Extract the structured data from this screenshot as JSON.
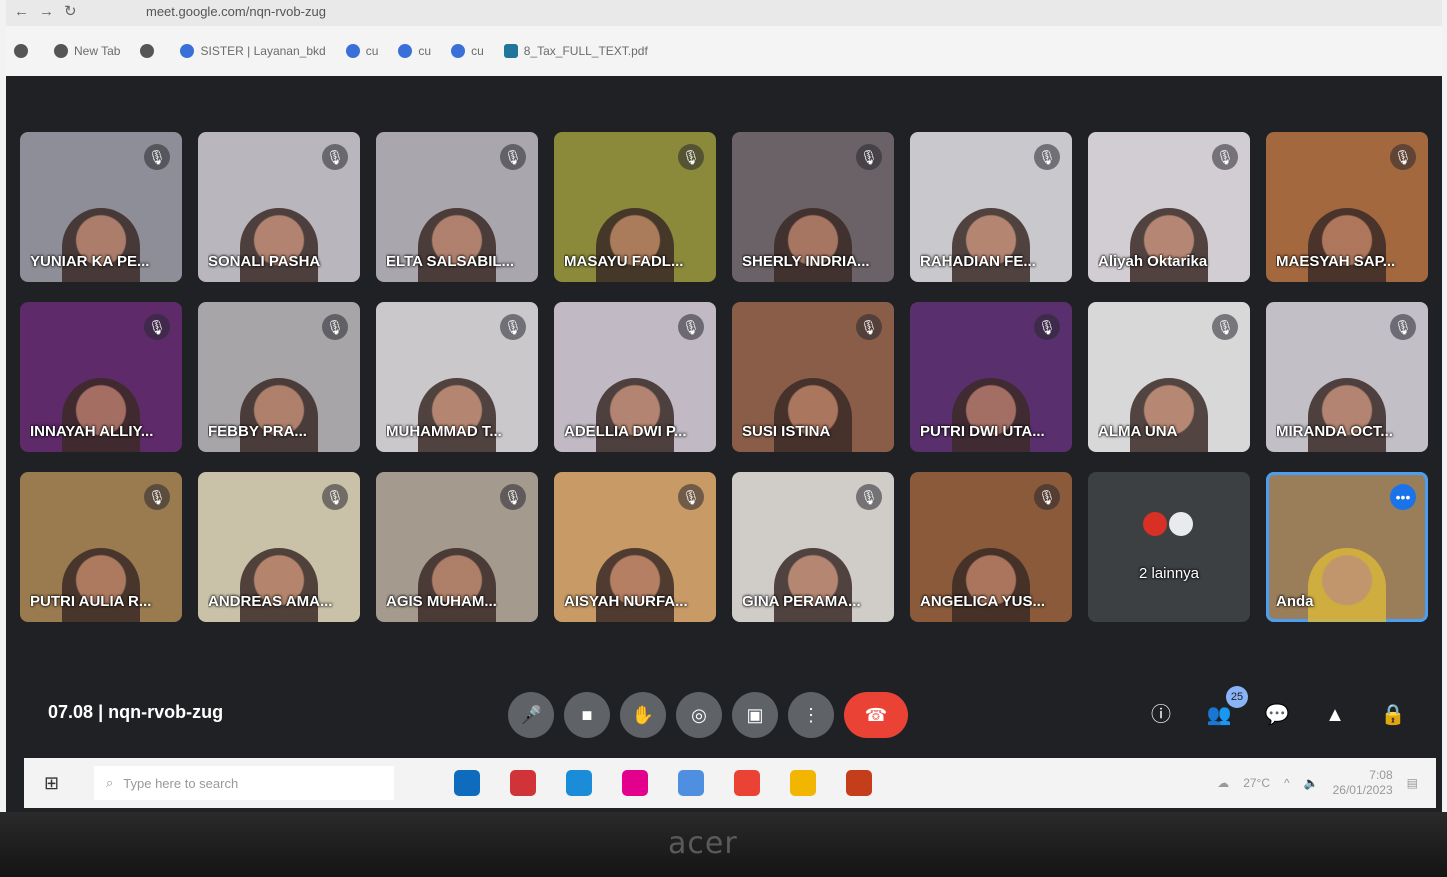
{
  "browser": {
    "url": "meet.google.com/nqn-rvob-zug",
    "bookmarks": [
      {
        "label": "",
        "icon": "globe-icon"
      },
      {
        "label": "New Tab",
        "icon": "globe-icon"
      },
      {
        "label": "",
        "icon": "globe-icon"
      },
      {
        "label": "SISTER | Layanan_bkd",
        "icon": "globe-icon"
      },
      {
        "label": "cu",
        "icon": "globe-icon"
      },
      {
        "label": "cu",
        "icon": "globe-icon"
      },
      {
        "label": "cu",
        "icon": "globe-icon"
      },
      {
        "label": "8_Tax_FULL_TEXT.pdf",
        "icon": "wordpress-icon"
      }
    ]
  },
  "participants": [
    {
      "name": "YUNIAR    KA PE...",
      "bg": "#8d8e98",
      "muted": true
    },
    {
      "name": "SONALI PASHA",
      "bg": "#b9b7bd",
      "muted": true
    },
    {
      "name": "ELTA SALSABIL...",
      "bg": "#a9a6ae",
      "muted": true
    },
    {
      "name": "MASAYU FADL...",
      "bg": "#8a8a3a",
      "muted": true
    },
    {
      "name": "SHERLY INDRIA...",
      "bg": "#6a6266",
      "muted": true
    },
    {
      "name": "RAHADIAN FE...",
      "bg": "#c9c8cc",
      "muted": true
    },
    {
      "name": "Aliyah Oktarika",
      "bg": "#d2cdd2",
      "muted": true
    },
    {
      "name": "MAESYAH SAP...",
      "bg": "#a4683e",
      "muted": true
    },
    {
      "name": "INNAYAH ALLIY...",
      "bg": "#5e2a6a",
      "muted": true
    },
    {
      "name": "FEBBY PRA...",
      "bg": "#a7a5a8",
      "muted": true
    },
    {
      "name": "MUHAMMAD T...",
      "bg": "#cbc8cc",
      "muted": true
    },
    {
      "name": "ADELLIA DWI P...",
      "bg": "#c1b9c4",
      "muted": true
    },
    {
      "name": "SUSI ISTINA",
      "bg": "#8a5d48",
      "muted": true
    },
    {
      "name": "PUTRI DWI UTA...",
      "bg": "#5a2f6e",
      "muted": true
    },
    {
      "name": "ALMA UNA",
      "bg": "#d8d8d8",
      "muted": true
    },
    {
      "name": "MIRANDA OCT...",
      "bg": "#c2bfc7",
      "muted": true
    },
    {
      "name": "PUTRI AULIA R...",
      "bg": "#9a7b4f",
      "muted": true
    },
    {
      "name": "ANDREAS AMA...",
      "bg": "#c9c2a8",
      "muted": true
    },
    {
      "name": "AGIS MUHAM...",
      "bg": "#a59a8e",
      "muted": true
    },
    {
      "name": "AISYAH NURFA...",
      "bg": "#c89a66",
      "muted": true
    },
    {
      "name": "GINA PERAMA...",
      "bg": "#d0ccc8",
      "muted": true
    },
    {
      "name": "ANGELICA YUS...",
      "bg": "#8a5a3a",
      "muted": true
    }
  ],
  "others_tile": {
    "label": "2 lainnya"
  },
  "self_tile": {
    "name": "Anda",
    "bg": "#9a7e5a"
  },
  "meeting": {
    "time": "07.08",
    "separator": "|",
    "code": "nqn-rvob-zug"
  },
  "controls": [
    {
      "name": "microphone-button",
      "icon": "🎤"
    },
    {
      "name": "camera-button",
      "icon": "■"
    },
    {
      "name": "raise-hand-button",
      "icon": "✋"
    },
    {
      "name": "captions-button",
      "icon": "◎"
    },
    {
      "name": "present-button",
      "icon": "▣"
    },
    {
      "name": "more-options-button",
      "icon": "⋮"
    }
  ],
  "end_call": {
    "icon": "☎"
  },
  "side_controls": [
    {
      "name": "info-button",
      "icon": "ⓘ",
      "badge": ""
    },
    {
      "name": "people-button",
      "icon": "👥",
      "badge": "25"
    },
    {
      "name": "chat-button",
      "icon": "💬",
      "badge": ""
    },
    {
      "name": "activities-button",
      "icon": "▲",
      "badge": ""
    },
    {
      "name": "host-controls-button",
      "icon": "🔒",
      "badge": ""
    }
  ],
  "taskbar": {
    "search_placeholder": "Type here to search",
    "weather": "27°C",
    "time": "7:08",
    "date": "26/01/2023",
    "app_colors": [
      "#0f6cbd",
      "#d13438",
      "#1a8cd8",
      "#e3008c",
      "#4f8fe0",
      "#ea4335",
      "#f2b600",
      "#c43e1c"
    ]
  },
  "laptop_brand": "acer"
}
